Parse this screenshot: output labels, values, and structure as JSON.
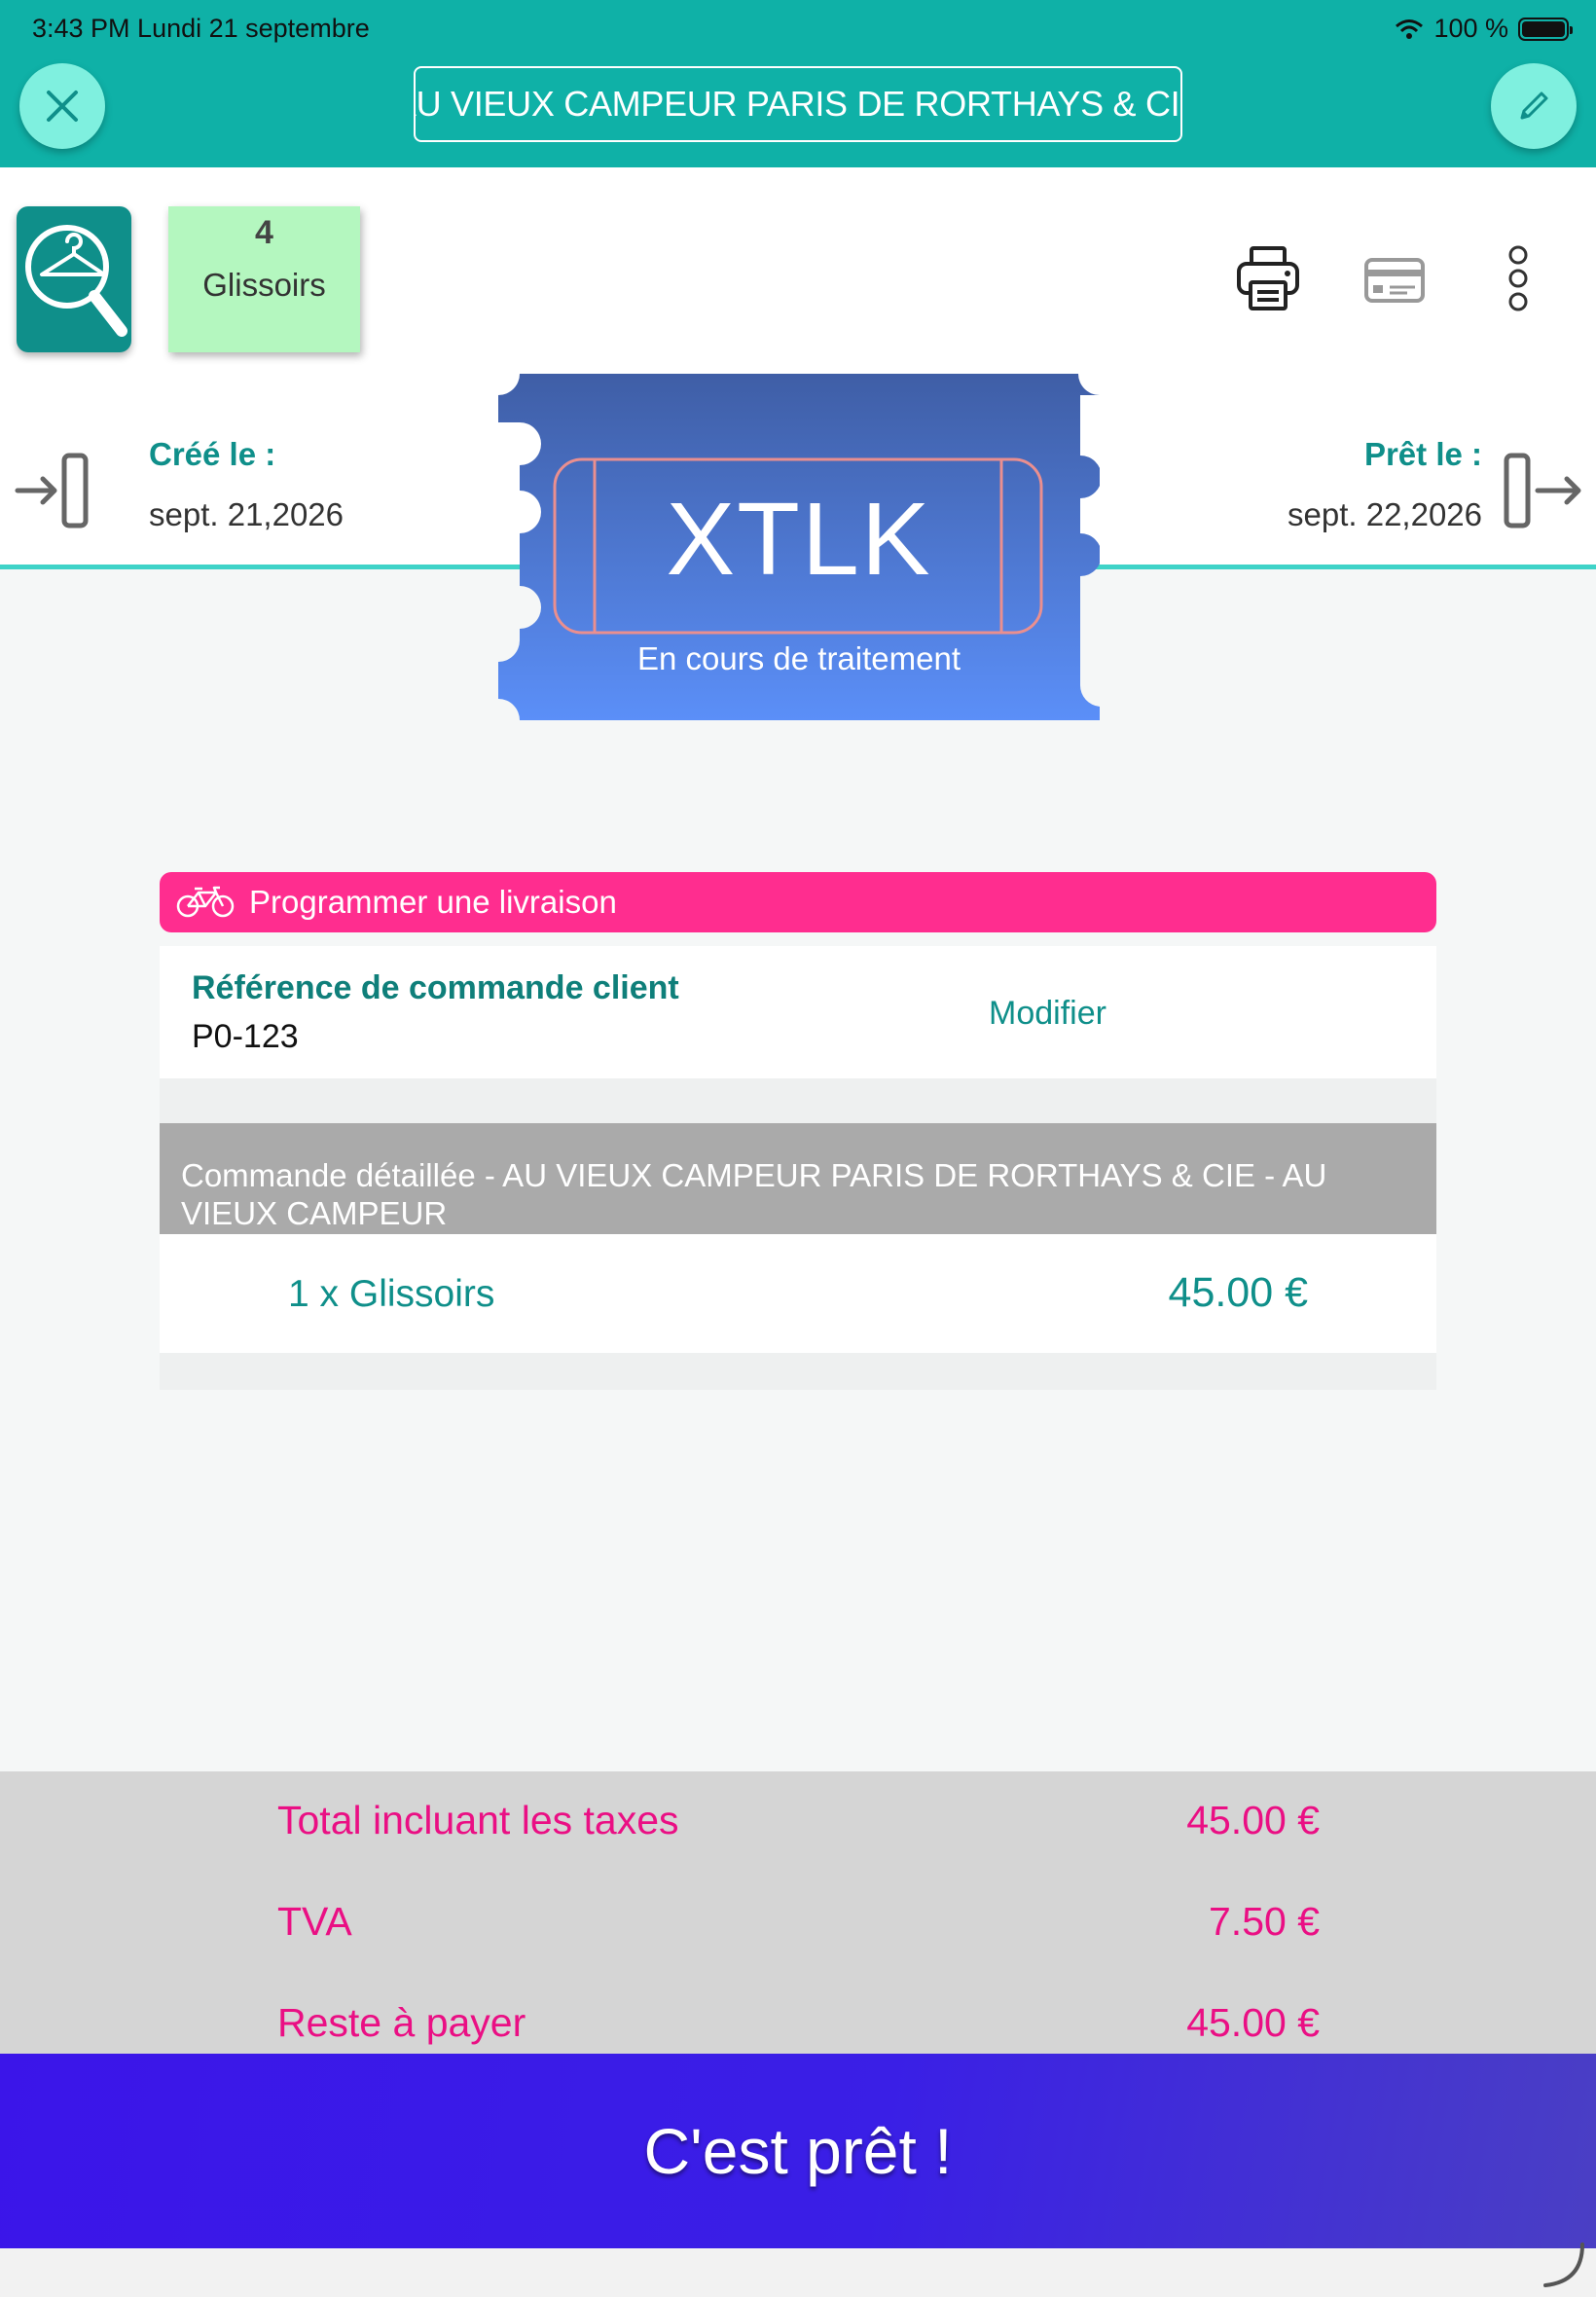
{
  "status_bar": {
    "time_date": "3:43 PM   Lundi 21 septembre",
    "battery": "100 %"
  },
  "header": {
    "client_name": "AU VIEUX CAMPEUR PARIS DE RORTHAYS & CIE",
    "close_icon": "close-icon",
    "edit_icon": "pencil-icon"
  },
  "toolbar": {
    "search_icon": "hanger-search-icon",
    "count": "4",
    "count_label": "Glissoirs",
    "actions": [
      "printer-icon",
      "card-icon",
      "more-vertical-icon"
    ]
  },
  "dates": {
    "created_label": "Créé le :",
    "created_value": "sept. 21,2026",
    "ready_label": "Prêt le :",
    "ready_value": "sept. 22,2026"
  },
  "ticket": {
    "code": "XTLK",
    "status": "En cours de traitement"
  },
  "delivery": {
    "label": "Programmer une livraison",
    "icon": "bicycle-icon"
  },
  "reference": {
    "label": "Référence de commande client",
    "value": "P0-123",
    "modify": "Modifier"
  },
  "order_details": {
    "header": "Commande détaillée - AU VIEUX CAMPEUR PARIS DE RORTHAYS & CIE - AU VIEUX CAMPEUR",
    "items": [
      {
        "label": "1 x Glissoirs",
        "price": "45.00  €"
      }
    ]
  },
  "totals": {
    "total_label": "Total incluant les taxes",
    "total_value": "45.00 €",
    "tva_label": "TVA",
    "tva_value": "7.50 €",
    "remaining_label": "Reste à payer",
    "remaining_value": "45.00 €"
  },
  "ready_button": "C'est prêt !",
  "colors": {
    "header": "#0fb1a7",
    "accent_teal": "#0f8f8a",
    "pink": "#ff2d8f",
    "totals_text": "#ea0f84",
    "button": "#3b15e9",
    "ticket_top": "#3f5ea6",
    "ticket_bottom": "#5b8ff8"
  }
}
